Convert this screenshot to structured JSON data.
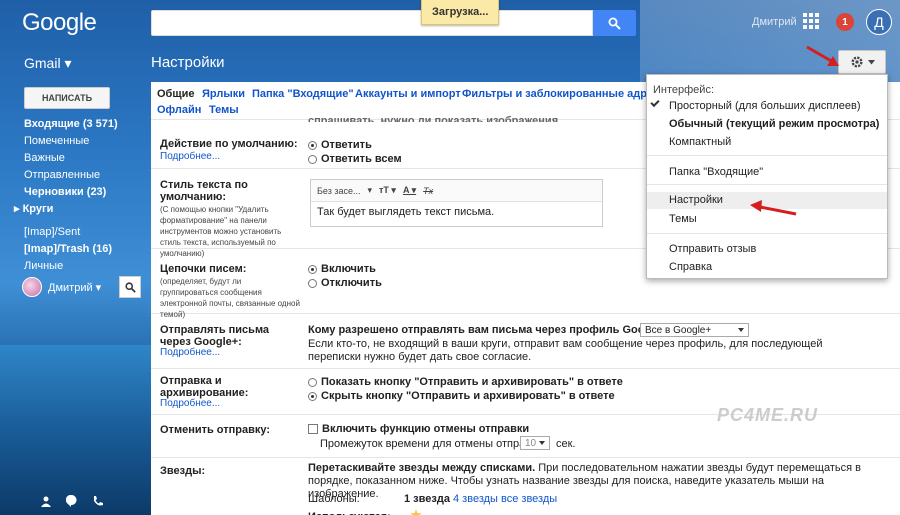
{
  "colors": {
    "accent": "#4285f4",
    "link": "#1155cc",
    "notification": "#db4437",
    "arrow": "#d61e1e"
  },
  "header": {
    "logo": "Google",
    "loading_text": "Загрузка...",
    "user_name": "Дмитрий",
    "notification_count": "1",
    "avatar_letter": "Д",
    "icons": [
      "search-icon",
      "apps-icon",
      "notifications-icon"
    ]
  },
  "subheader": {
    "app_label": "Gmail ▾",
    "page_title": "Настройки"
  },
  "sidebar": {
    "compose_label": "НАПИСАТЬ",
    "items": [
      {
        "label": "Входящие (3 571)",
        "bold": true
      },
      {
        "label": "Помеченные",
        "bold": false
      },
      {
        "label": "Важные",
        "bold": false
      },
      {
        "label": "Отправленные",
        "bold": false
      },
      {
        "label": "Черновики (23)",
        "bold": true
      },
      {
        "label": "▸ Круги",
        "bold": true
      },
      {
        "label": "[Imap]/Sent",
        "bold": false
      },
      {
        "label": "[Imap]/Trash (16)",
        "bold": true
      },
      {
        "label": "Личные",
        "bold": false
      }
    ],
    "chat_user": "Дмитрий ▾"
  },
  "tabs": [
    "Общие",
    "Ярлыки",
    "Папка \"Входящие\"",
    "Аккаунты и импорт",
    "Фильтры и заблокированные адреса",
    "Офлайн",
    "Темы"
  ],
  "settings": {
    "partial_text": "спрашивать, нужно ли показать изображения",
    "default_action": {
      "label": "Действие по умолчанию:",
      "more": "Подробнее...",
      "options": [
        "Ответить",
        "Ответить всем"
      ],
      "selected": 0
    },
    "text_style": {
      "label": "Стиль текста по умолчанию:",
      "description": "(С помощью кнопки \"Удалить форматирование\" на панели инструментов можно установить стиль текста, используемый по умолчанию)",
      "font": "Без засе...",
      "preview": "Так будет выглядеть текст письма."
    },
    "threads": {
      "label": "Цепочки писем:",
      "description": "(определяет, будут ли группироваться сообщения электронной почты, связанные одной темой)",
      "options": [
        "Включить",
        "Отключить"
      ],
      "selected": 0
    },
    "gplus": {
      "label": "Отправлять письма через Google+:",
      "more": "Подробнее...",
      "question": "Кому разрешено отправлять вам письма через профиль Google+?",
      "select_value": "Все в Google+",
      "note": "Если кто-то, не входящий в ваши круги, отправит вам сообщение через профиль, для последующей переписки нужно будет дать свое согласие."
    },
    "send_archive": {
      "label": "Отправка и архивирование:",
      "more": "Подробнее...",
      "options": [
        "Показать кнопку \"Отправить и архивировать\" в ответе",
        "Скрыть кнопку \"Отправить и архивировать\" в ответе"
      ],
      "selected": 1
    },
    "undo_send": {
      "label": "Отменить отправку:",
      "checkbox_label": "Включить функцию отмены отправки",
      "period_label": "Промежуток времени для отмены отправки:",
      "period_value": "10",
      "period_unit": "сек."
    },
    "stars": {
      "label": "Звезды:",
      "intro_bold": "Перетаскивайте звезды между списками.",
      "intro_rest": " При последовательном нажатии звезды будут перемещаться в порядке, показанном ниже. Чтобы узнать название звезды для поиска, наведите указатель мыши на изображение.",
      "presets_label": "Шаблоны:",
      "preset_selected": "1 звезда",
      "preset_links": [
        "4 звезды",
        "все звезды"
      ],
      "in_use_label": "Используются:"
    }
  },
  "watermark": "PC4ME.RU",
  "menu": {
    "heading": "Интерфейс:",
    "density": [
      {
        "label": "Просторный (для больших дисплеев)",
        "checked": true,
        "bold": false
      },
      {
        "label": "Обычный (текущий режим просмотра)",
        "checked": false,
        "bold": true
      },
      {
        "label": "Компактный",
        "checked": false,
        "bold": false
      }
    ],
    "inbox": "Папка \"Входящие\"",
    "settings": "Настройки",
    "themes": "Темы",
    "feedback": "Отправить отзыв",
    "help": "Справка"
  }
}
